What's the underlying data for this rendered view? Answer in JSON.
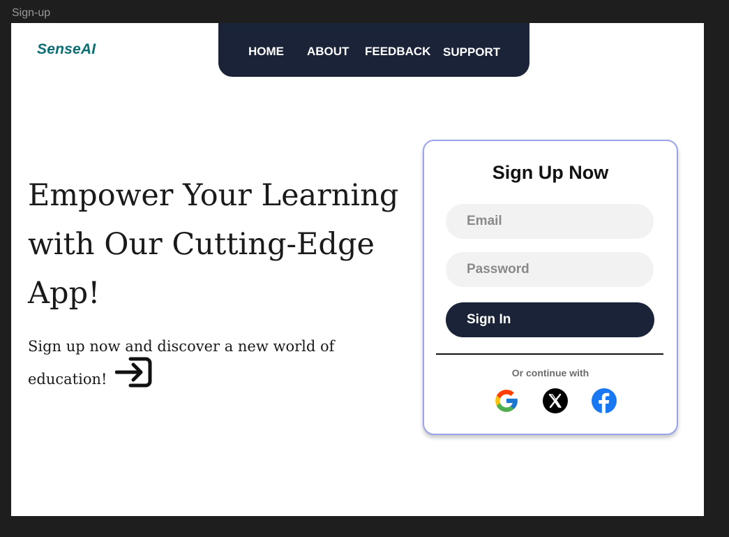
{
  "frame": {
    "label": "Sign-up"
  },
  "brand": {
    "name": "SenseAI",
    "color": "#0c6f73"
  },
  "nav": {
    "background": "#1b2339",
    "items": [
      {
        "label": "HOME"
      },
      {
        "label": "ABOUT"
      },
      {
        "label": "FEEDBACK"
      },
      {
        "label": "SUPPORT"
      }
    ]
  },
  "hero": {
    "title_lines": [
      "Empower Your Learning",
      "with Our Cutting-Edge",
      "App!"
    ],
    "subtitle": "Sign up now and discover a new world of education!",
    "icon": "sign-in-arrow-icon"
  },
  "signup": {
    "title": "Sign Up Now",
    "email_placeholder": "Email",
    "password_placeholder": "Password",
    "submit_label": "Sign In",
    "alt_text": "Or continue with",
    "border_color": "#9aa2ec",
    "socials": [
      {
        "name": "google",
        "icon": "google-icon"
      },
      {
        "name": "x",
        "icon": "x-icon"
      },
      {
        "name": "facebook",
        "icon": "facebook-icon"
      }
    ]
  }
}
